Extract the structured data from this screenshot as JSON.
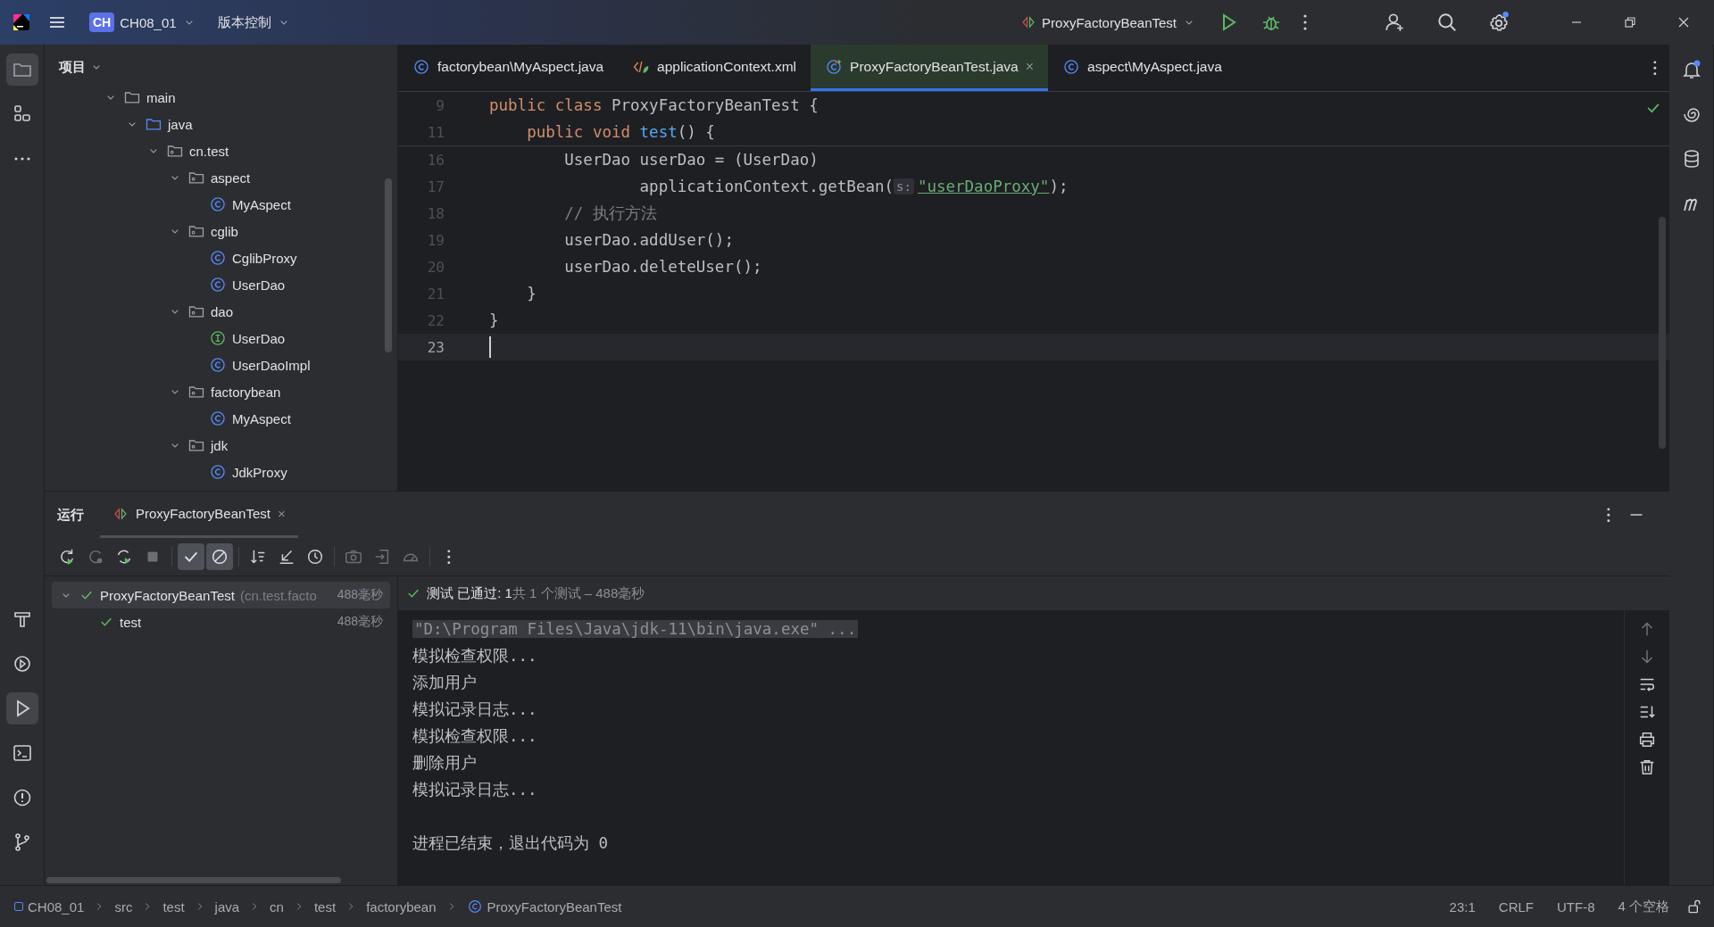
{
  "title_bar": {
    "project_badge": "CH",
    "project": "CH08_01",
    "vcs": "版本控制",
    "run_config": "ProxyFactoryBeanTest"
  },
  "left_strip": {
    "top": [
      {
        "kind": "project",
        "selected": true
      },
      {
        "kind": "structure",
        "selected": false
      },
      {
        "kind": "more",
        "selected": false
      }
    ],
    "bottom": [
      {
        "kind": "build",
        "selected": false
      },
      {
        "kind": "services",
        "selected": false
      },
      {
        "kind": "run",
        "selected": true
      },
      {
        "kind": "terminal",
        "selected": false
      },
      {
        "kind": "problems",
        "selected": false
      },
      {
        "kind": "git",
        "selected": false
      }
    ]
  },
  "project_panel": {
    "title": "项目",
    "tree": [
      {
        "label": "main",
        "kind": "folder",
        "expanded": true,
        "children": [
          {
            "label": "java",
            "kind": "source-root",
            "expanded": true,
            "children": [
              {
                "label": "cn.test",
                "kind": "package",
                "expanded": true,
                "children": [
                  {
                    "label": "aspect",
                    "kind": "package",
                    "expanded": true,
                    "children": [
                      {
                        "label": "MyAspect",
                        "kind": "class"
                      }
                    ]
                  },
                  {
                    "label": "cglib",
                    "kind": "package",
                    "expanded": true,
                    "children": [
                      {
                        "label": "CglibProxy",
                        "kind": "class"
                      },
                      {
                        "label": "UserDao",
                        "kind": "class"
                      }
                    ]
                  },
                  {
                    "label": "dao",
                    "kind": "package",
                    "expanded": true,
                    "children": [
                      {
                        "label": "UserDao",
                        "kind": "interface"
                      },
                      {
                        "label": "UserDaoImpl",
                        "kind": "class"
                      }
                    ]
                  },
                  {
                    "label": "factorybean",
                    "kind": "package",
                    "expanded": true,
                    "children": [
                      {
                        "label": "MyAspect",
                        "kind": "class"
                      }
                    ]
                  },
                  {
                    "label": "jdk",
                    "kind": "package",
                    "expanded": true,
                    "children": [
                      {
                        "label": "JdkProxy",
                        "kind": "class"
                      }
                    ]
                  }
                ]
              }
            ]
          }
        ]
      }
    ]
  },
  "editor": {
    "tabs": [
      {
        "label": "factorybean\\MyAspect.java",
        "kind": "java",
        "selected": false
      },
      {
        "label": "applicationContext.xml",
        "kind": "xml",
        "selected": false
      },
      {
        "label": "ProxyFactoryBeanTest.java",
        "kind": "test",
        "selected": true,
        "close": "×"
      },
      {
        "label": "aspect\\MyAspect.java",
        "kind": "java",
        "selected": false
      }
    ],
    "sticky_lines": [
      {
        "number": "9",
        "tokens": [
          {
            "kind": "keyword",
            "text": "public class "
          },
          {
            "kind": "plain",
            "text": "ProxyFactoryBeanTest {"
          }
        ]
      },
      {
        "number": "11",
        "tokens": [
          {
            "kind": "keyword",
            "text": "    public void "
          },
          {
            "kind": "method",
            "text": "test"
          },
          {
            "kind": "plain",
            "text": "() {"
          }
        ]
      }
    ],
    "lines": [
      {
        "number": "16",
        "current": false,
        "tokens": [
          {
            "kind": "plain",
            "text": "        UserDao userDao = (UserDao)"
          }
        ]
      },
      {
        "number": "17",
        "current": false,
        "tokens": [
          {
            "kind": "plain",
            "text": "                applicationContext.getBean("
          },
          {
            "kind": "hint",
            "text": "s:"
          },
          {
            "kind": "string",
            "text": "\"userDaoProxy\""
          },
          {
            "kind": "plain",
            "text": ");"
          }
        ]
      },
      {
        "number": "18",
        "current": false,
        "tokens": [
          {
            "kind": "comment",
            "text": "        // 执行方法"
          }
        ]
      },
      {
        "number": "19",
        "current": false,
        "tokens": [
          {
            "kind": "plain",
            "text": "        userDao.addUser();"
          }
        ]
      },
      {
        "number": "20",
        "current": false,
        "tokens": [
          {
            "kind": "plain",
            "text": "        userDao.deleteUser();"
          }
        ]
      },
      {
        "number": "21",
        "current": false,
        "tokens": [
          {
            "kind": "plain",
            "text": "    }"
          }
        ]
      },
      {
        "number": "22",
        "current": false,
        "tokens": [
          {
            "kind": "plain",
            "text": "}"
          }
        ]
      },
      {
        "number": "23",
        "current": true
      }
    ]
  },
  "run_panel": {
    "title": "运行",
    "tab": {
      "label": "ProxyFactoryBeanTest",
      "selected": true,
      "close": "×"
    },
    "toolbar": [
      {
        "kind": "rerun",
        "disabled": false
      },
      {
        "kind": "rerun-failed",
        "disabled": true
      },
      {
        "kind": "toggle-auto",
        "disabled": false
      },
      {
        "kind": "stop",
        "disabled": true
      },
      {
        "kind": "show-passed",
        "on": true,
        "disabled": false
      },
      {
        "kind": "show-ignored",
        "on": true,
        "disabled": false
      },
      {
        "kind": "sort",
        "disabled": false
      },
      {
        "kind": "collapse",
        "disabled": false
      },
      {
        "kind": "history",
        "disabled": false
      },
      {
        "kind": "camera",
        "disabled": true
      },
      {
        "kind": "import",
        "disabled": true
      },
      {
        "kind": "coverage",
        "disabled": true
      },
      {
        "kind": "more",
        "disabled": false
      }
    ],
    "tests": [
      {
        "label": "ProxyFactoryBeanTest",
        "detail": "(cn.test.facto",
        "time": "488毫秒",
        "passed": true,
        "selected": true,
        "expanded": true,
        "children": [
          {
            "label": "test",
            "time": "488毫秒",
            "passed": true,
            "selected": false
          }
        ]
      }
    ],
    "status": {
      "passed": true,
      "summary": "测试 已通过: 1",
      "detail": "共 1 个测试 – 488毫秒"
    },
    "console": [
      {
        "kind": "command",
        "text": "\"D:\\Program Files\\Java\\jdk-11\\bin\\java.exe\" ..."
      },
      {
        "kind": "output",
        "text": "模拟检查权限..."
      },
      {
        "kind": "output",
        "text": "添加用户"
      },
      {
        "kind": "output",
        "text": "模拟记录日志..."
      },
      {
        "kind": "output",
        "text": "模拟检查权限..."
      },
      {
        "kind": "output",
        "text": "删除用户"
      },
      {
        "kind": "output",
        "text": "模拟记录日志..."
      },
      {
        "kind": "blank"
      },
      {
        "kind": "output",
        "text": "进程已结束，退出代码为 0"
      }
    ]
  },
  "status_bar": {
    "breadcrumbs": [
      {
        "label": "CH08_01",
        "kind": "module"
      },
      {
        "label": "src",
        "kind": "plain"
      },
      {
        "label": "test",
        "kind": "plain"
      },
      {
        "label": "java",
        "kind": "plain"
      },
      {
        "label": "cn",
        "kind": "plain"
      },
      {
        "label": "test",
        "kind": "plain"
      },
      {
        "label": "factorybean",
        "kind": "plain"
      },
      {
        "label": "ProxyFactoryBeanTest",
        "kind": "class"
      }
    ],
    "position": "23:1",
    "line_separator": "CRLF",
    "encoding": "UTF-8",
    "indent": "4 个空格"
  }
}
